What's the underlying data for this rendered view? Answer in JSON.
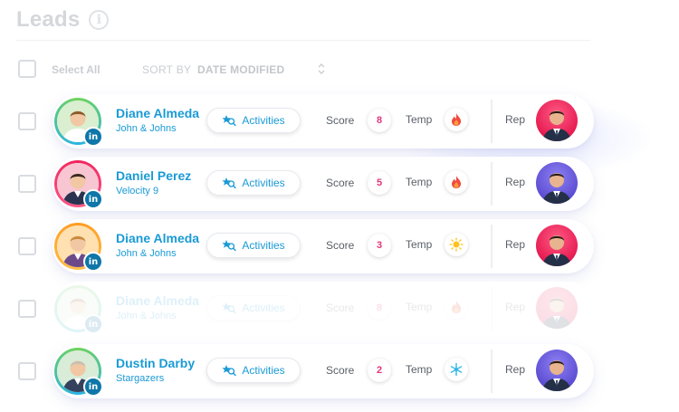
{
  "header": {
    "title": "Leads",
    "info_icon": "info-icon"
  },
  "toolbar": {
    "select_all": "Select All",
    "sort_by": "SORT BY",
    "sort_value": "DATE MODIFIED"
  },
  "labels": {
    "activities": "Activities",
    "score": "Score",
    "temp": "Temp",
    "rep": "Rep",
    "linkedin": "in"
  },
  "colors": {
    "accent": "#1a9ad6",
    "score": "#e5367f",
    "linkedin": "#0e76a8"
  },
  "leads": [
    {
      "name": "Diane Almeda",
      "company": "John & Johns",
      "score": "8",
      "temp_icon": "fire-icon",
      "rep": "red",
      "ring": "green"
    },
    {
      "name": "Daniel Perez",
      "company": "Velocity 9",
      "score": "5",
      "temp_icon": "fire-icon",
      "rep": "purple",
      "ring": "red"
    },
    {
      "name": "Diane Almeda",
      "company": "John & Johns",
      "score": "3",
      "temp_icon": "sun-icon",
      "rep": "red",
      "ring": "orange"
    },
    {
      "name": "Diane Almeda",
      "company": "John & Johns",
      "score": "8",
      "temp_icon": "fire-icon",
      "rep": "red",
      "ring": "green",
      "faded": true
    },
    {
      "name": "Dustin Darby",
      "company": "Stargazers",
      "score": "2",
      "temp_icon": "snowflake-icon",
      "rep": "purple",
      "ring": "green"
    }
  ]
}
